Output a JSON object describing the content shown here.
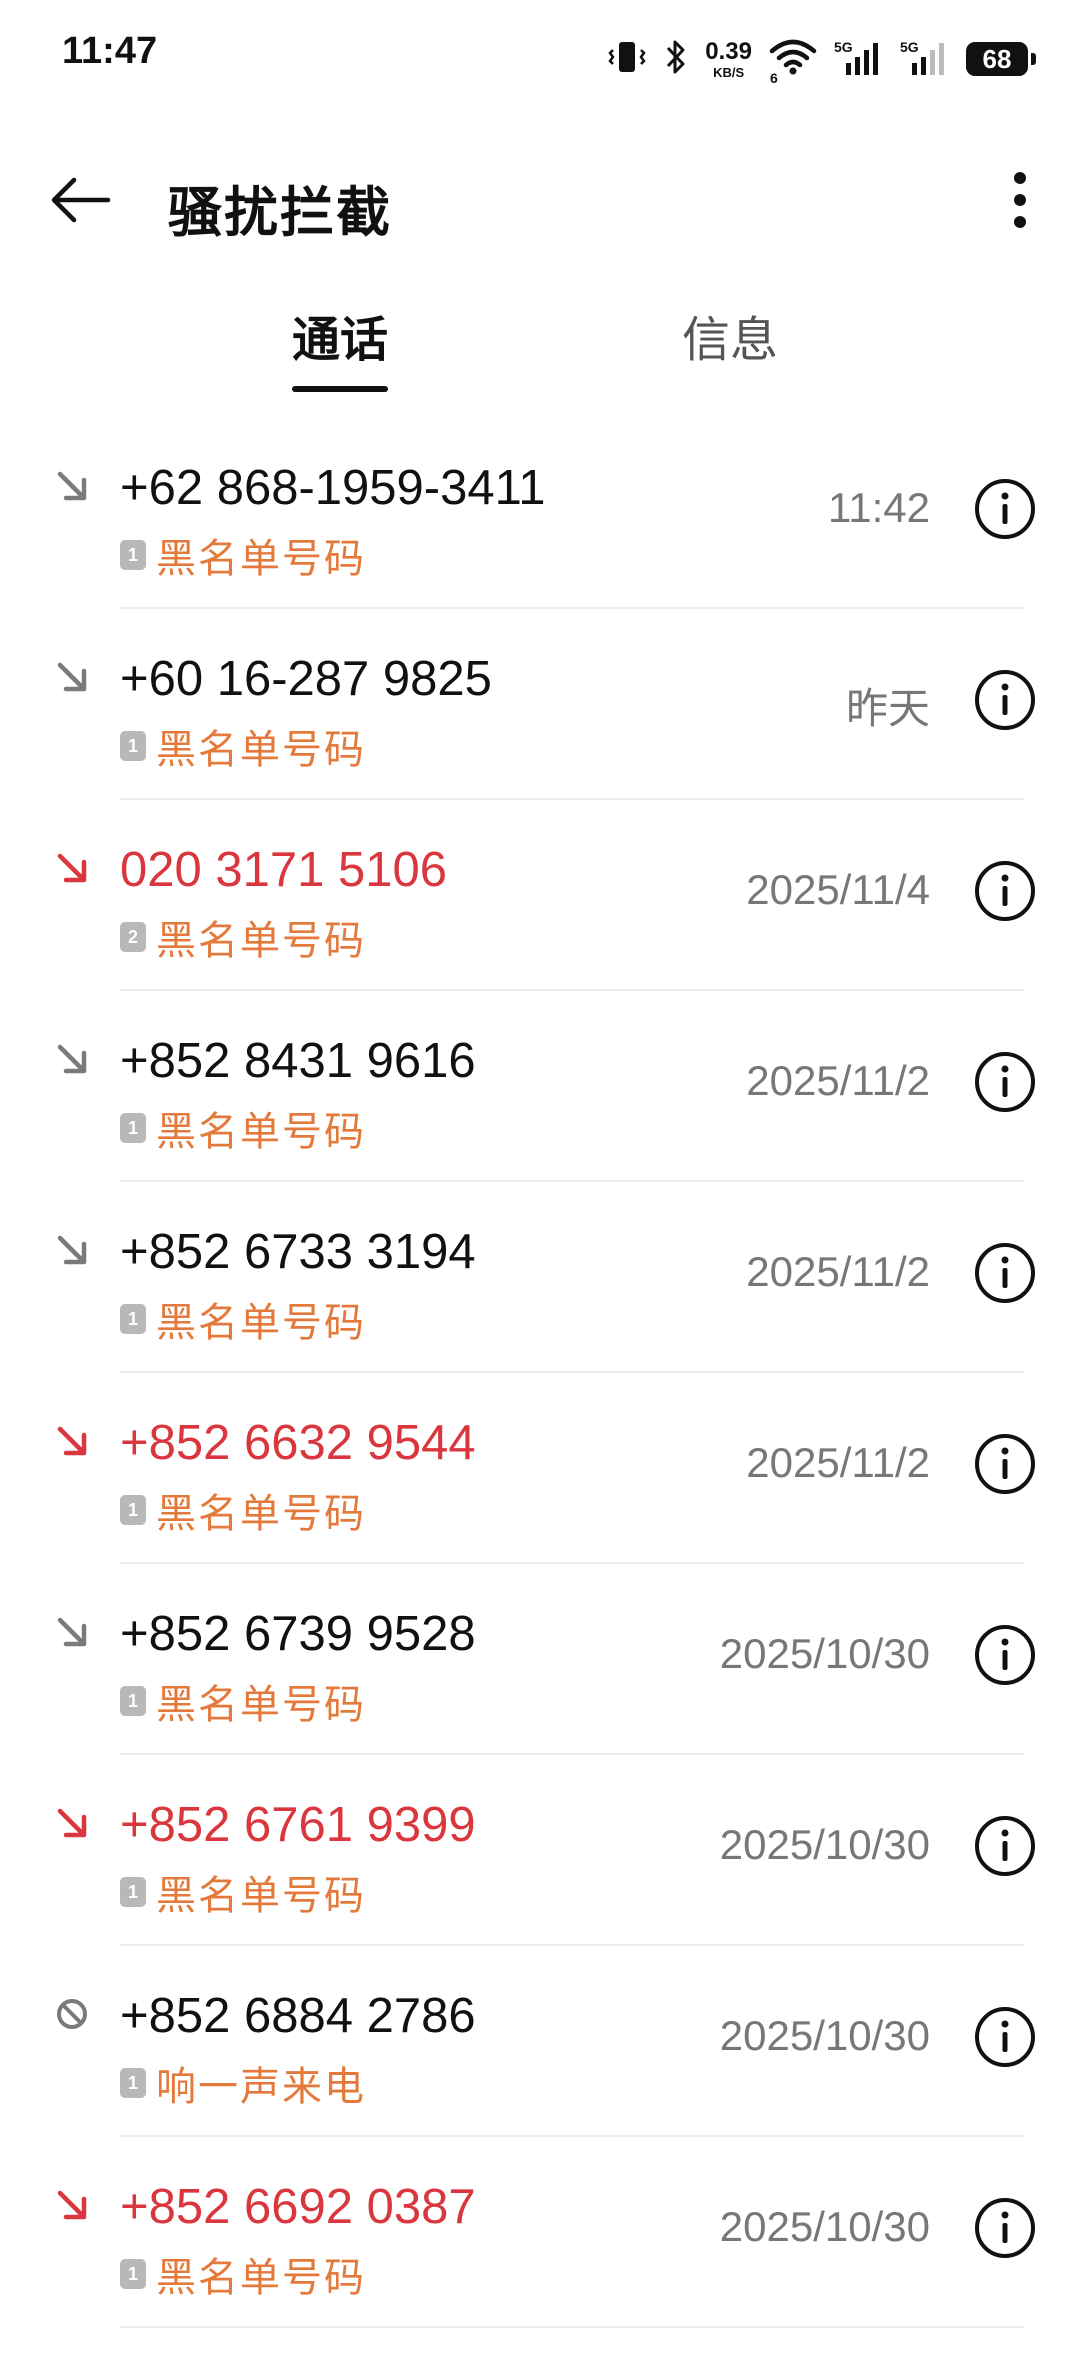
{
  "status_bar": {
    "time": "11:47",
    "net_speed_value": "0.39",
    "net_speed_unit": "KB/S",
    "wifi_sub": "6",
    "sim1_label": "5G",
    "sim2_label": "5G",
    "battery": "68",
    "icons": [
      "vibrate-icon",
      "bluetooth-icon",
      "wifi-icon",
      "signal-icon",
      "signal-icon",
      "battery-icon"
    ]
  },
  "header": {
    "title": "骚扰拦截",
    "back_icon": "back-arrow-icon",
    "more_icon": "more-vertical-icon"
  },
  "tabs": [
    {
      "label": "通话",
      "active": true
    },
    {
      "label": "信息",
      "active": false
    }
  ],
  "colors": {
    "missed": "#d9363e",
    "tag": "#e37a3c",
    "incoming_icon": "#7a7a7a"
  },
  "calls": [
    {
      "number": "+62 868-1959-3411",
      "sim": "1",
      "tag": "黑名单号码",
      "time": "11:42",
      "type": "incoming-blocked"
    },
    {
      "number": "+60 16-287 9825",
      "sim": "1",
      "tag": "黑名单号码",
      "time": "昨天",
      "type": "incoming-blocked"
    },
    {
      "number": "020 3171 5106",
      "sim": "2",
      "tag": "黑名单号码",
      "time": "2025/11/4",
      "type": "missed"
    },
    {
      "number": "+852 8431 9616",
      "sim": "1",
      "tag": "黑名单号码",
      "time": "2025/11/2",
      "type": "incoming-blocked"
    },
    {
      "number": "+852 6733 3194",
      "sim": "1",
      "tag": "黑名单号码",
      "time": "2025/11/2",
      "type": "incoming-blocked"
    },
    {
      "number": "+852 6632 9544",
      "sim": "1",
      "tag": "黑名单号码",
      "time": "2025/11/2",
      "type": "missed"
    },
    {
      "number": "+852 6739 9528",
      "sim": "1",
      "tag": "黑名单号码",
      "time": "2025/10/30",
      "type": "incoming-blocked"
    },
    {
      "number": "+852 6761 9399",
      "sim": "1",
      "tag": "黑名单号码",
      "time": "2025/10/30",
      "type": "missed"
    },
    {
      "number": "+852 6884 2786",
      "sim": "1",
      "tag": "响一声来电",
      "time": "2025/10/30",
      "type": "rejected"
    },
    {
      "number": "+852 6692 0387",
      "sim": "1",
      "tag": "黑名单号码",
      "time": "2025/10/30",
      "type": "missed"
    }
  ]
}
